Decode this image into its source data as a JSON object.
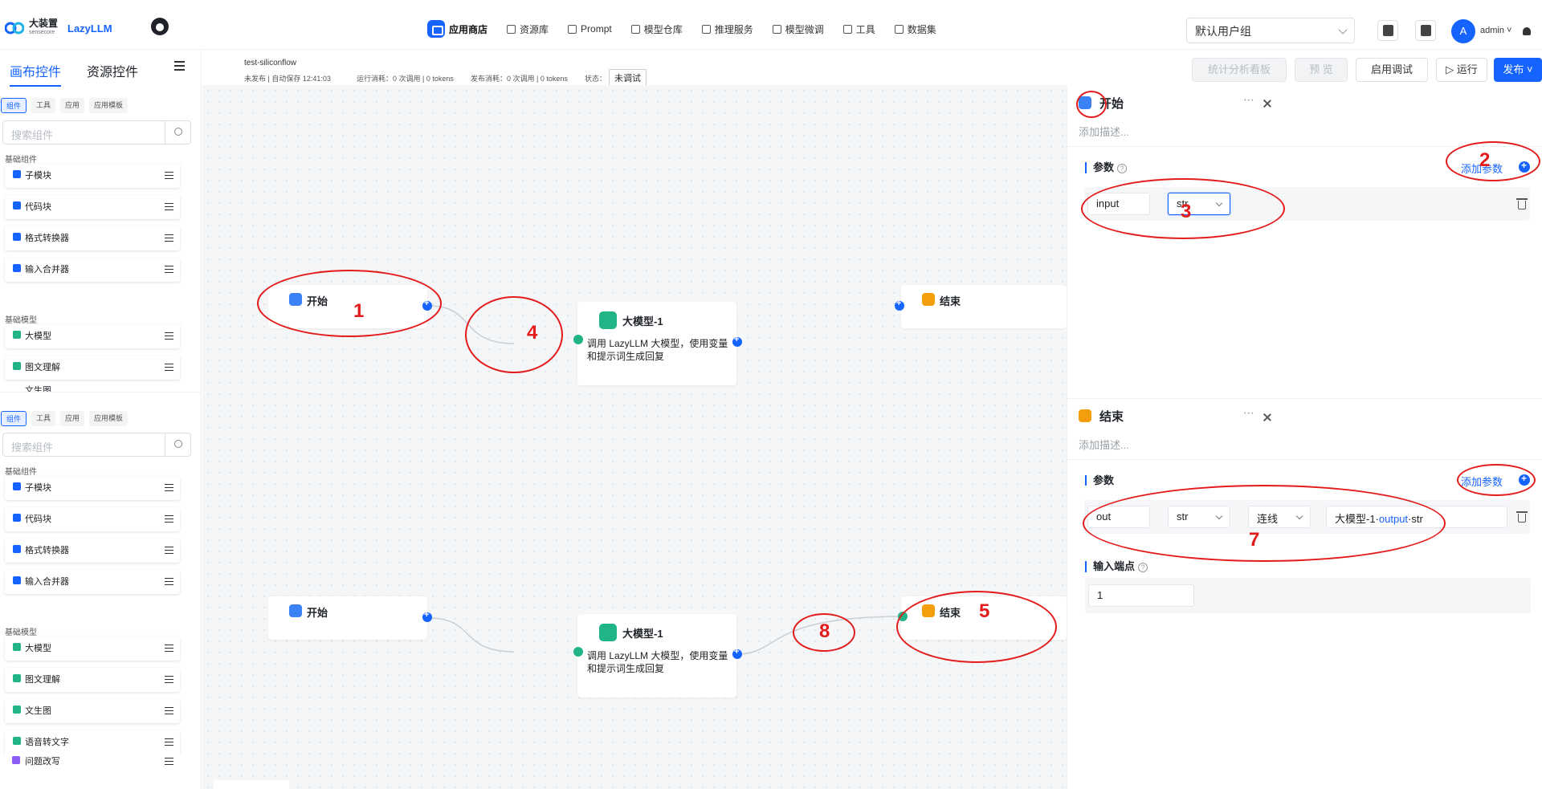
{
  "brand": {
    "name_cn": "大装置",
    "name_sub": "sensecore",
    "name_en": "LazyLLM",
    "github_icon": "github-icon"
  },
  "nav": [
    {
      "label": "应用商店",
      "active": true
    },
    {
      "label": "资源库"
    },
    {
      "label": "Prompt"
    },
    {
      "label": "模型仓库"
    },
    {
      "label": "推理服务"
    },
    {
      "label": "模型微调"
    },
    {
      "label": "工具"
    },
    {
      "label": "数据集"
    }
  ],
  "user": {
    "group": "默认用户组",
    "avatar": "A",
    "name": "admin ˅"
  },
  "sidebar": {
    "tabs": [
      "画布控件",
      "资源控件"
    ],
    "chips": [
      "组件",
      "工具",
      "应用",
      "应用模板"
    ],
    "search_placeholder": "搜索组件",
    "basic_components_title": "基础组件",
    "basic_components": [
      "子模块",
      "代码块",
      "格式转换器",
      "输入合并器"
    ],
    "basic_models_title": "基础模型",
    "basic_models_top": [
      "大模型",
      "图文理解",
      "文生图"
    ],
    "basic_models_bottom": [
      "大模型",
      "图文理解",
      "文生图",
      "语音转文字",
      "问题改写"
    ]
  },
  "header": {
    "workflow_name": "test-siliconflow",
    "save_status": "未发布 | 自动保存 12:41:03",
    "run_cost": "运行消耗：0 次调用 | 0 tokens",
    "publish_cost": "发布消耗：0 次调用 | 0 tokens",
    "status_label": "状态：",
    "status_value": "未调试",
    "buttons": {
      "stats": "统计分析看板",
      "preview": "预 览",
      "debug": "启用调试",
      "run": "▷ 运行",
      "publish": "发布 ˅"
    }
  },
  "canvas": {
    "start_label": "开始",
    "llm_label": "大模型-1",
    "llm_desc": "调用 LazyLLM 大模型，使用变量和提示词生成回复",
    "end_label": "结束"
  },
  "annotations": [
    "1",
    "2",
    "3",
    "4",
    "5",
    "7",
    "8"
  ],
  "panel_start": {
    "title": "开始",
    "desc_placeholder": "添加描述...",
    "params_title": "参数",
    "add_param": "添加参数",
    "param_name": "input",
    "param_type": "str"
  },
  "panel_end": {
    "title": "结束",
    "desc_placeholder": "添加描述...",
    "params_title": "参数",
    "add_param": "添加参数",
    "param_name": "out",
    "param_type": "str",
    "param_mode": "连线",
    "ref_prefix": "大模型-1·",
    "ref_mid": "output",
    "ref_suffix": "·str",
    "input_port_title": "输入端点",
    "input_port_value": "1"
  },
  "colors": {
    "accent": "#1664ff",
    "annotation": "#e31b1b",
    "success": "#20b486",
    "end_icon": "#f59e0b"
  }
}
